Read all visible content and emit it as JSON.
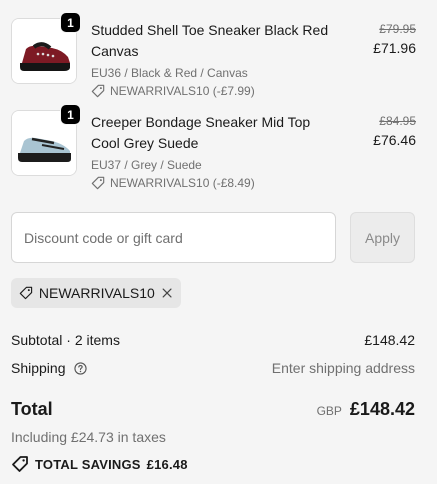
{
  "items": [
    {
      "qty": "1",
      "name": "Studded Shell Toe Sneaker Black Red Canvas",
      "variant": "EU36 / Black & Red / Canvas",
      "discount": "NEWARRIVALS10 (-£7.99)",
      "old_price": "£79.95",
      "price": "£71.96",
      "thumb_icon": "black-red-sneaker"
    },
    {
      "qty": "1",
      "name": "Creeper Bondage Sneaker Mid Top Cool Grey Suede",
      "variant": "EU37 / Grey / Suede",
      "discount": "NEWARRIVALS10 (-£8.49)",
      "old_price": "£84.95",
      "price": "£76.46",
      "thumb_icon": "grey-creeper-sneaker"
    }
  ],
  "discount_field": {
    "placeholder": "Discount code or gift card",
    "value": "",
    "apply_label": "Apply"
  },
  "applied_code": {
    "code": "NEWARRIVALS10",
    "icon": "tag-icon",
    "remove_icon": "close-icon"
  },
  "summary": {
    "subtotal_label": "Subtotal · 2 items",
    "subtotal_value": "£148.42",
    "shipping_label": "Shipping",
    "shipping_value": "Enter shipping address",
    "total_label": "Total",
    "currency": "GBP",
    "total_value": "£148.42",
    "taxes_note": "Including £24.73 in taxes",
    "savings_label": "TOTAL SAVINGS",
    "savings_value": "£16.48"
  },
  "colors": {
    "background": "#f5f5f5",
    "text": "#1a1a1a",
    "muted": "#707070",
    "chip": "#e6e6e6"
  }
}
